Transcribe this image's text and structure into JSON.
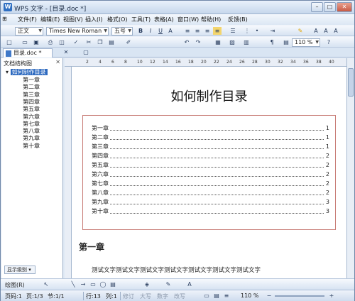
{
  "window": {
    "title": "WPS 文字 - [目录.doc *]",
    "app_icon": "W"
  },
  "menu": [
    "文件(F)",
    "编辑(E)",
    "视图(V)",
    "插入(I)",
    "格式(O)",
    "工具(T)",
    "表格(A)",
    "窗口(W)",
    "帮助(H)",
    "反馈(B)"
  ],
  "toolbar": {
    "style": "正文",
    "font": "Times New Roman",
    "size": "五号",
    "zoom": "110 %",
    "bold": "B",
    "italic": "I",
    "underline": "U"
  },
  "tab": {
    "label": "目录.doc *"
  },
  "sidebar": {
    "title": "文档结构图",
    "root": "如何制作目录",
    "items": [
      "第一章",
      "第二章",
      "第三章",
      "第四章",
      "第五章",
      "第六章",
      "第七章",
      "第八章",
      "第九章",
      "第十章"
    ],
    "level_button": "显示级别"
  },
  "ruler": [
    "2",
    "4",
    "6",
    "8",
    "10",
    "12",
    "14",
    "16",
    "18",
    "20",
    "22",
    "24",
    "26",
    "28",
    "30",
    "32",
    "34",
    "36",
    "38",
    "40"
  ],
  "document": {
    "title": "如何制作目录",
    "toc": [
      {
        "label": "第一章",
        "page": "1"
      },
      {
        "label": "第二章",
        "page": "1"
      },
      {
        "label": "第三章",
        "page": "1"
      },
      {
        "label": "第四章",
        "page": "2"
      },
      {
        "label": "第五章",
        "page": "2"
      },
      {
        "label": "第六章",
        "page": "2"
      },
      {
        "label": "第七章",
        "page": "2"
      },
      {
        "label": "第八章",
        "page": "2"
      },
      {
        "label": "第九章",
        "page": "3"
      },
      {
        "label": "第十章",
        "page": "3"
      }
    ],
    "heading": "第一章",
    "body": "测试文字测试文字测试文字测试文字测试文字测试文字测试文字"
  },
  "drawbar": {
    "label": "绘图(R)"
  },
  "status": {
    "page": "页码:1",
    "pages": "页:1/3",
    "section": "节:1/1",
    "row": "行:13",
    "col": "列:1",
    "rec": "修订",
    "caps": "大写",
    "num": "数字",
    "ovr": "改写",
    "zoom": "110 %"
  }
}
